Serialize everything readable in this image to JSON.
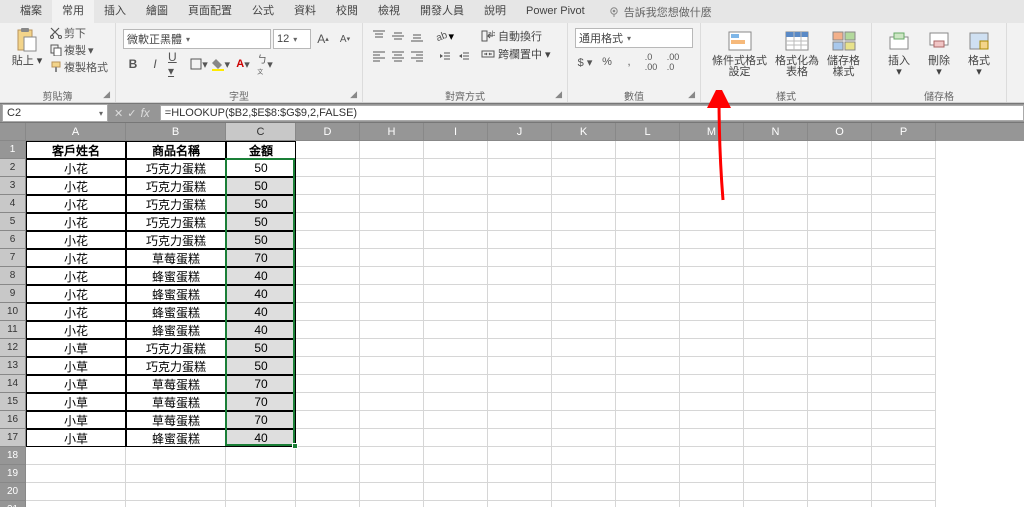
{
  "menu": [
    "檔案",
    "常用",
    "插入",
    "繪圖",
    "頁面配置",
    "公式",
    "資料",
    "校閱",
    "檢視",
    "開發人員",
    "說明",
    "Power Pivot"
  ],
  "menu_active": 1,
  "tell_me": "告訴我您想做什麼",
  "ribbon": {
    "clipboard": {
      "paste": "貼上",
      "cut": "剪下",
      "copy": "複製",
      "format_painter": "複製格式",
      "label": "剪貼簿"
    },
    "font": {
      "name": "微軟正黑體",
      "size": "12",
      "label": "字型"
    },
    "align": {
      "wrap": "自動換行",
      "merge": "跨欄置中",
      "label": "對齊方式"
    },
    "number": {
      "fmt": "通用格式",
      "label": "數值"
    },
    "styles": {
      "cond": "條件式格式\n設定",
      "astable": "格式化為\n表格",
      "cellstyle": "儲存格\n樣式",
      "label": "樣式"
    },
    "cells": {
      "insert": "插入",
      "delete": "刪除",
      "format": "格式",
      "label": "儲存格"
    }
  },
  "namebox": "C2",
  "formula": "=HLOOKUP($B2,$E$8:$G$9,2,FALSE)",
  "cols": [
    "A",
    "B",
    "C",
    "D",
    "H",
    "I",
    "J",
    "K",
    "L",
    "M",
    "N",
    "O",
    "P"
  ],
  "headers": {
    "A": "客戶姓名",
    "B": "商品名稱",
    "C": "金額"
  },
  "rows": [
    {
      "n": 2,
      "A": "小花",
      "B": "巧克力蛋糕",
      "C": "50",
      "white": true
    },
    {
      "n": 3,
      "A": "小花",
      "B": "巧克力蛋糕",
      "C": "50"
    },
    {
      "n": 4,
      "A": "小花",
      "B": "巧克力蛋糕",
      "C": "50"
    },
    {
      "n": 5,
      "A": "小花",
      "B": "巧克力蛋糕",
      "C": "50"
    },
    {
      "n": 6,
      "A": "小花",
      "B": "巧克力蛋糕",
      "C": "50"
    },
    {
      "n": 7,
      "A": "小花",
      "B": "草莓蛋糕",
      "C": "70"
    },
    {
      "n": 8,
      "A": "小花",
      "B": "蜂蜜蛋糕",
      "C": "40"
    },
    {
      "n": 9,
      "A": "小花",
      "B": "蜂蜜蛋糕",
      "C": "40"
    },
    {
      "n": 10,
      "A": "小花",
      "B": "蜂蜜蛋糕",
      "C": "40"
    },
    {
      "n": 11,
      "A": "小花",
      "B": "蜂蜜蛋糕",
      "C": "40"
    },
    {
      "n": 12,
      "A": "小草",
      "B": "巧克力蛋糕",
      "C": "50"
    },
    {
      "n": 13,
      "A": "小草",
      "B": "巧克力蛋糕",
      "C": "50"
    },
    {
      "n": 14,
      "A": "小草",
      "B": "草莓蛋糕",
      "C": "70"
    },
    {
      "n": 15,
      "A": "小草",
      "B": "草莓蛋糕",
      "C": "70"
    },
    {
      "n": 16,
      "A": "小草",
      "B": "草莓蛋糕",
      "C": "70"
    },
    {
      "n": 17,
      "A": "小草",
      "B": "蜂蜜蛋糕",
      "C": "40"
    }
  ]
}
